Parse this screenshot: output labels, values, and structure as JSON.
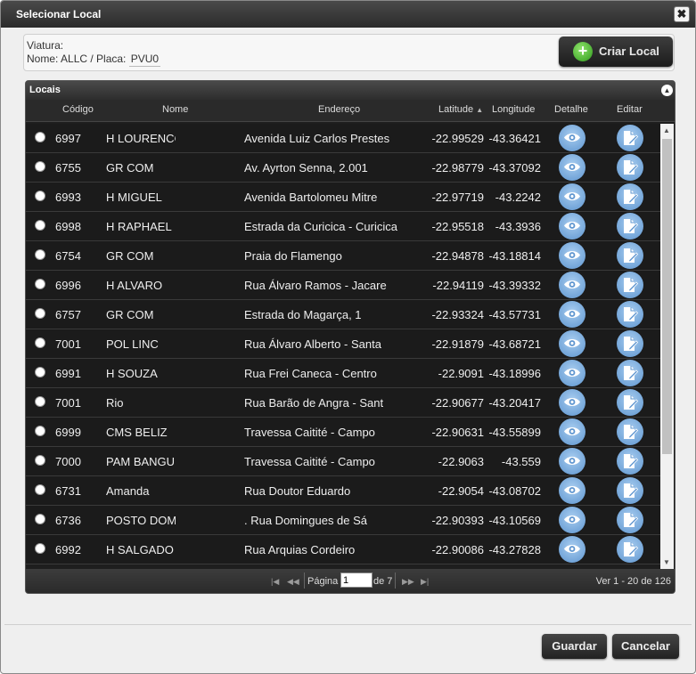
{
  "dialog": {
    "title": "Selecionar Local"
  },
  "info": {
    "viatura_label": "Viatura:",
    "nome_placa": "Nome: ALLC / Placa:",
    "placa_value": "PVU0"
  },
  "criar_local": {
    "label": "Criar Local",
    "icon": "plus-circle-icon",
    "color": "#2f9a1c"
  },
  "grid": {
    "title": "Locais",
    "columns": {
      "codigo": "Código",
      "nome": "Nome",
      "endereco": "Endereço",
      "latitude": "Latitude",
      "longitude": "Longitude",
      "detalhe": "Detalhe",
      "editar": "Editar"
    },
    "sort": {
      "column": "latitude",
      "direction": "descending"
    },
    "rows": [
      {
        "codigo": "6997",
        "nome": "H LOURENCO",
        "endereco": "Avenida Luiz Carlos Prestes",
        "lat": "-22.99529",
        "lng": "-43.36421"
      },
      {
        "codigo": "6755",
        "nome": "GR COM",
        "endereco": "Av. Ayrton Senna, 2.001",
        "lat": "-22.98779",
        "lng": "-43.37092"
      },
      {
        "codigo": "6993",
        "nome": "H MIGUEL",
        "endereco": "Avenida Bartolomeu Mitre",
        "lat": "-22.97719",
        "lng": "-43.2242"
      },
      {
        "codigo": "6998",
        "nome": "H RAPHAEL",
        "endereco": "Estrada da Curicica - Curicica",
        "lat": "-22.95518",
        "lng": "-43.3936"
      },
      {
        "codigo": "6754",
        "nome": "GR COM",
        "endereco": "Praia do Flamengo",
        "lat": "-22.94878",
        "lng": "-43.18814"
      },
      {
        "codigo": "6996",
        "nome": "H ALVARO",
        "endereco": "Rua Álvaro Ramos - Jacare",
        "lat": "-22.94119",
        "lng": "-43.39332"
      },
      {
        "codigo": "6757",
        "nome": "GR COM",
        "endereco": "Estrada do Magarça, 1",
        "lat": "-22.93324",
        "lng": "-43.57731"
      },
      {
        "codigo": "7001",
        "nome": "POL LINC",
        "endereco": "Rua Álvaro Alberto - Santa",
        "lat": "-22.91879",
        "lng": "-43.68721"
      },
      {
        "codigo": "6991",
        "nome": "H SOUZA",
        "endereco": "Rua Frei Caneca - Centro",
        "lat": "-22.9091",
        "lng": "-43.18996"
      },
      {
        "codigo": "7001",
        "nome": "Rio",
        "endereco": "Rua Barão de Angra - Sant",
        "lat": "-22.90677",
        "lng": "-43.20417"
      },
      {
        "codigo": "6999",
        "nome": "CMS BELIZ",
        "endereco": "Travessa Caitité - Campo",
        "lat": "-22.90631",
        "lng": "-43.55899"
      },
      {
        "codigo": "7000",
        "nome": "PAM BANGU",
        "endereco": "Travessa Caitité - Campo",
        "lat": "-22.9063",
        "lng": "-43.559"
      },
      {
        "codigo": "6731",
        "nome": "Amanda",
        "endereco": "Rua Doutor Eduardo",
        "lat": "-22.9054",
        "lng": "-43.08702"
      },
      {
        "codigo": "6736",
        "nome": "POSTO DOMI",
        "endereco": ". Rua Domingues de Sá",
        "lat": "-22.90393",
        "lng": "-43.10569"
      },
      {
        "codigo": "6992",
        "nome": "H SALGADO",
        "endereco": "Rua Arquias Cordeiro",
        "lat": "-22.90086",
        "lng": "-43.27828"
      }
    ]
  },
  "pager": {
    "page_label": "Página",
    "page_value": "1",
    "of_label": "de 7",
    "summary": "Ver 1 - 20 de 126"
  },
  "buttons": {
    "guardar": "Guardar",
    "cancelar": "Cancelar"
  }
}
